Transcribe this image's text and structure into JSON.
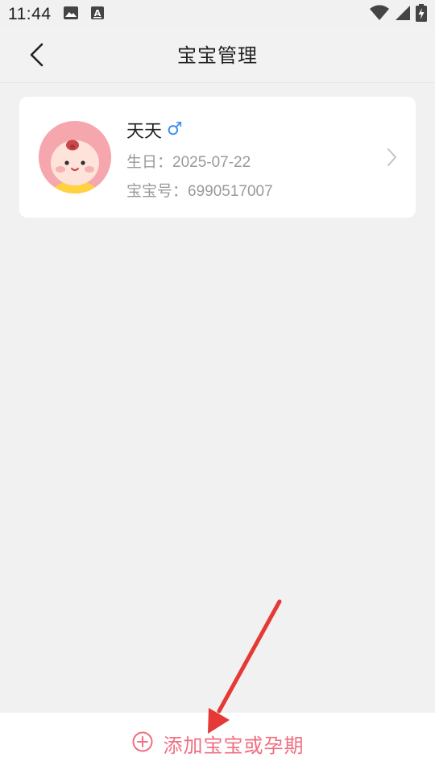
{
  "status_bar": {
    "time": "11:44",
    "icons": [
      "image-icon",
      "a-box-icon",
      "wifi-icon",
      "signal-icon",
      "battery-charging-icon"
    ]
  },
  "header": {
    "title": "宝宝管理",
    "back_icon": "chevron-left-icon"
  },
  "baby": {
    "name": "天天",
    "gender_symbol": "♂",
    "birthday": "生日：2025-07-22",
    "baby_id": "宝宝号：6990517007"
  },
  "bottom": {
    "add_label": "添加宝宝或孕期",
    "add_icon": "plus-circle-icon"
  },
  "colors": {
    "accent": "#f06f82",
    "gender_male": "#3d8ef0",
    "annotation_arrow": "#e53935"
  }
}
